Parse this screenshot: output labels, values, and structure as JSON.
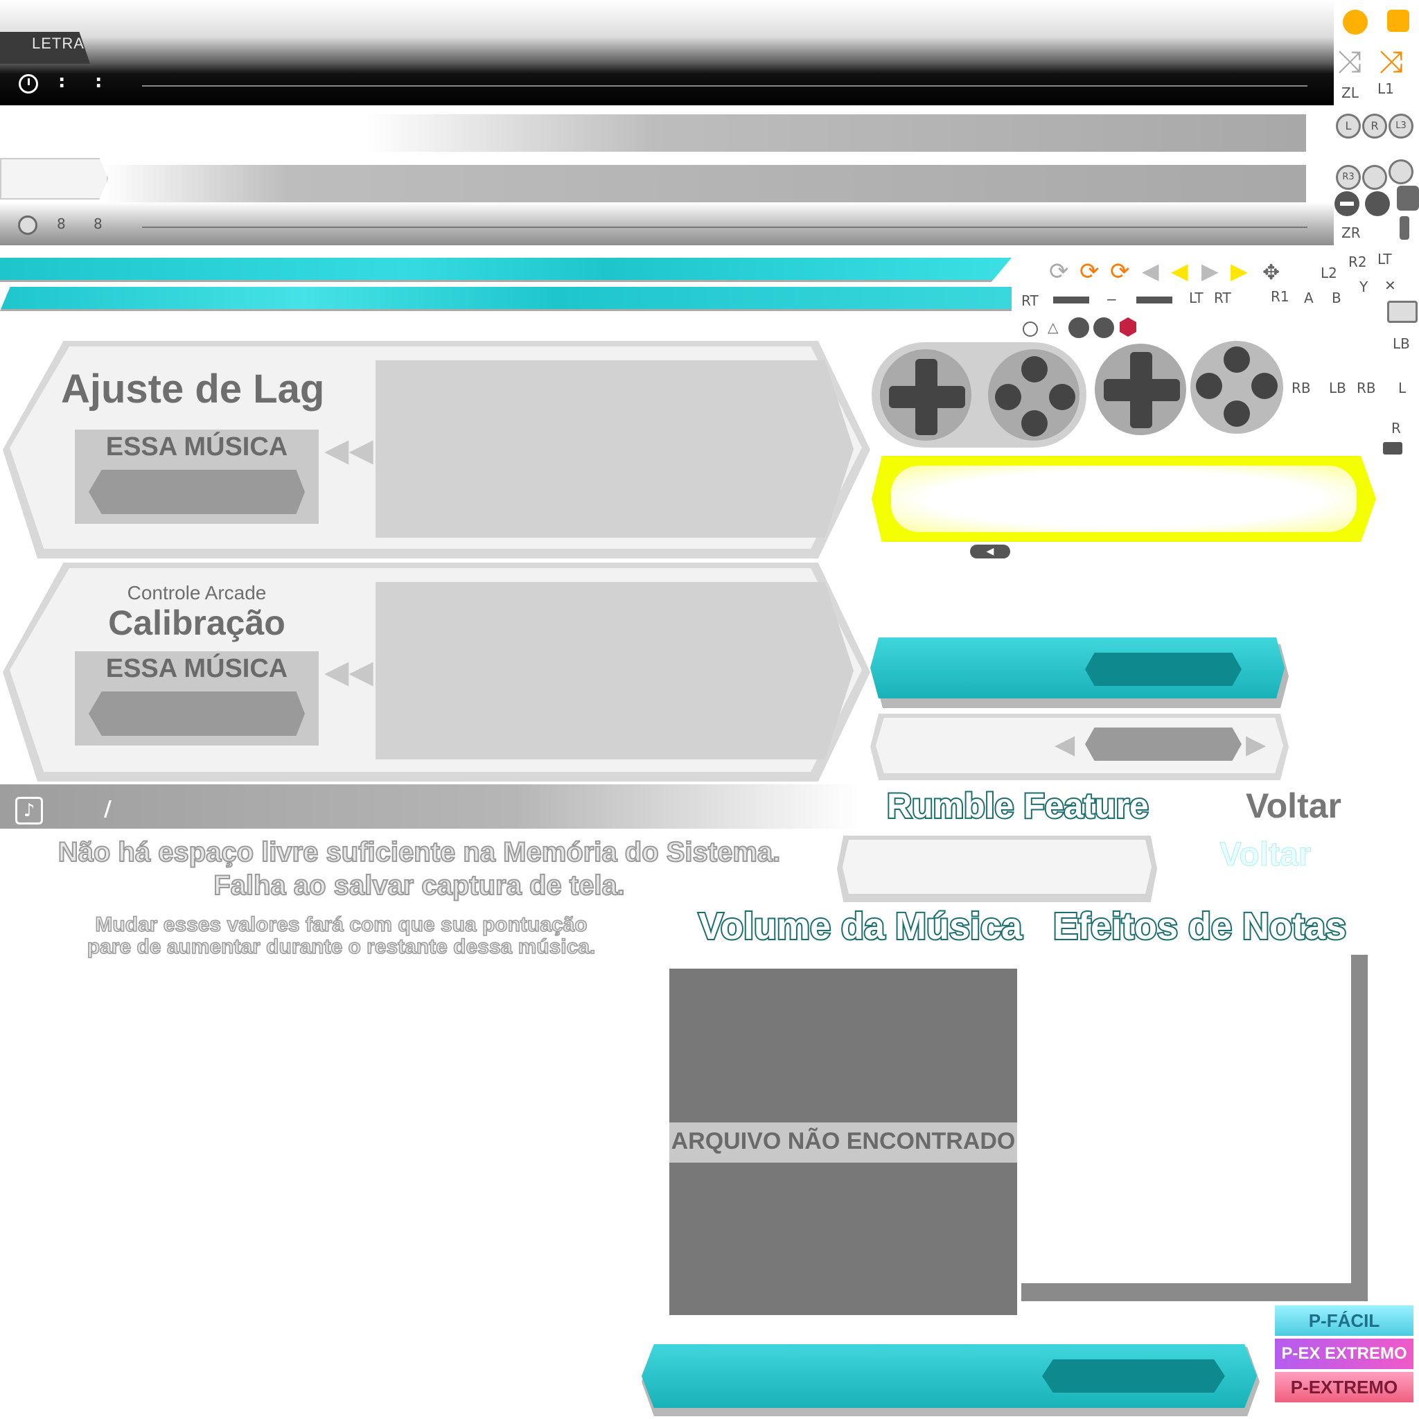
{
  "lyrics_bar": {
    "label": "LETRA",
    "colon_1": ":",
    "colon_2": ":"
  },
  "lyrics_bar_small": {
    "colon_1": "8",
    "colon_2": "8"
  },
  "lag_panel": {
    "title": "Ajuste de Lag",
    "scope": "ESSA MÚSICA"
  },
  "calibration_panel": {
    "subtitle": "Controle Arcade",
    "title": "Calibração",
    "scope": "ESSA MÚSICA"
  },
  "song_bar": {
    "separator": "/"
  },
  "messages": {
    "storage_line1": "Não há espaço livre suficiente na Memória do Sistema.",
    "storage_line2": "Falha ao salvar captura de tela.",
    "score_line1": "Mudar esses valores fará com que sua pontuação",
    "score_line2": "pare de aumentar durante o restante dessa música."
  },
  "headings": {
    "rumble": "Rumble Feature",
    "back_dark": "Voltar",
    "back_light": "Voltar",
    "music_volume": "Volume da Música",
    "note_effects": "Efeitos de Notas"
  },
  "file_missing": "ARQUIVO NÃO ENCONTRADO",
  "difficulty_tags": [
    "P-FÁCIL",
    "P-EX EXTREMO",
    "P-EXTREMO"
  ],
  "controller_labels": {
    "top": [
      "ZL",
      "L1"
    ],
    "zr": "ZR",
    "r2": "R2",
    "lt_top": "LT",
    "l2": "L2",
    "y": "Y",
    "x": "✕",
    "row2": [
      "RT",
      "−",
      "LT",
      "RT",
      "R1",
      "A",
      "B"
    ],
    "lb": "LB",
    "row4": [
      "RB",
      "LB",
      "RB",
      "L"
    ],
    "r": "R",
    "stick_letters": [
      "L",
      "R",
      "L3",
      "R3"
    ]
  },
  "colors": {
    "teal": "#18b8bf",
    "teal_dark": "#0e8a8e",
    "yellow_glow": "#f4ff00",
    "orange": "#ff8a00",
    "grey_dark": "#787878"
  }
}
